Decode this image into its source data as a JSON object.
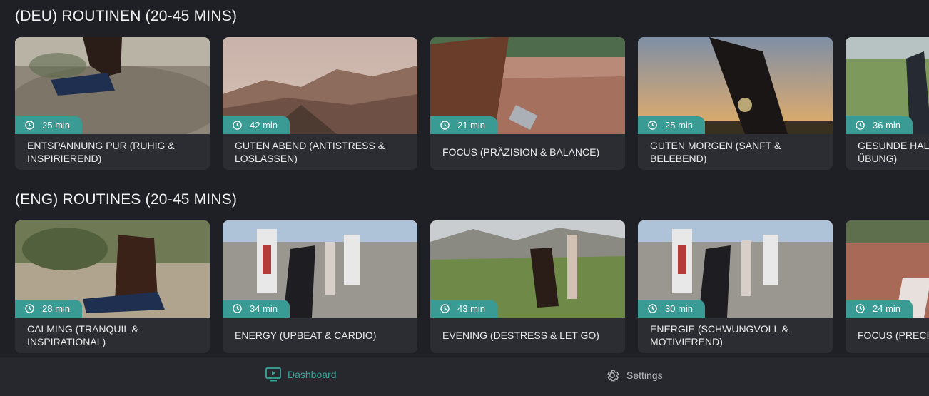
{
  "sections": [
    {
      "title": "(DEU) ROUTINEN (20-45 MINS)",
      "cards": [
        {
          "duration": "25 min",
          "label": "ENTSPANNUNG PUR (RUHIG &\nINSPIRIEREND)"
        },
        {
          "duration": "42 min",
          "label": "GUTEN ABEND (ANTISTRESS &\nLOSLASSEN)"
        },
        {
          "duration": "21 min",
          "label": "FOCUS (PRÄZISION & BALANCE)"
        },
        {
          "duration": "25 min",
          "label": "GUTEN MORGEN (SANFT &\nBELEBEND)"
        },
        {
          "duration": "36 min",
          "label": "GESUNDE HAL\nÜBUNG)"
        }
      ]
    },
    {
      "title": "(ENG) ROUTINES (20-45 MINS)",
      "cards": [
        {
          "duration": "28 min",
          "label": "CALMING (TRANQUIL &\nINSPIRATIONAL)"
        },
        {
          "duration": "34 min",
          "label": "ENERGY (UPBEAT & CARDIO)"
        },
        {
          "duration": "43 min",
          "label": "EVENING (DESTRESS & LET GO)"
        },
        {
          "duration": "30 min",
          "label": "ENERGIE (SCHWUNGVOLL &\nMOTIVIEREND)"
        },
        {
          "duration": "24 min",
          "label": "FOCUS (PRECI"
        }
      ]
    }
  ],
  "nav": {
    "dashboard": "Dashboard",
    "settings": "Settings"
  },
  "colors": {
    "accent": "#3a9b94",
    "background": "#1f2025",
    "card": "#2b2d33"
  }
}
